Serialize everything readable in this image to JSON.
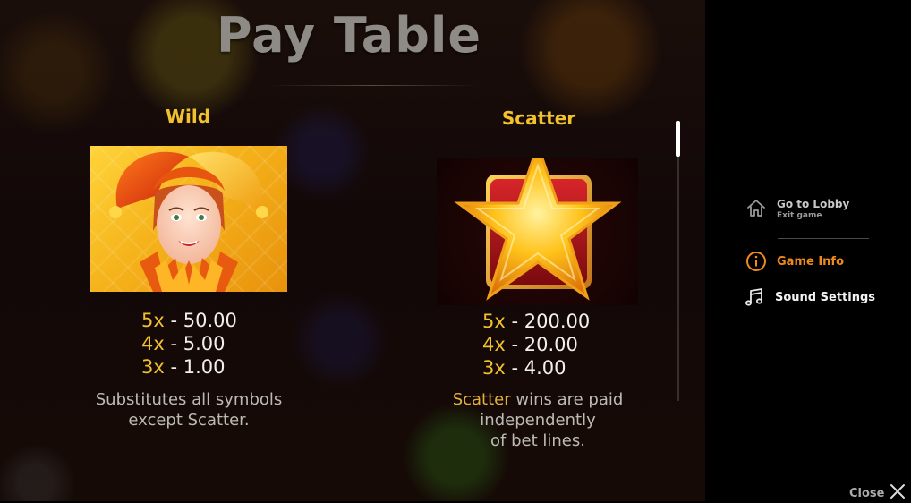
{
  "header": {
    "title": "Pay Table"
  },
  "wild": {
    "name": "Wild",
    "payouts": [
      {
        "mult": "5x",
        "sep": " - ",
        "value": "50.00"
      },
      {
        "mult": "4x",
        "sep": " - ",
        "value": "5.00"
      },
      {
        "mult": "3x",
        "sep": " - ",
        "value": "1.00"
      }
    ],
    "desc_line1": "Substitutes all symbols",
    "desc_line2": "except Scatter."
  },
  "scatter": {
    "name": "Scatter",
    "payouts": [
      {
        "mult": "5x",
        "sep": " - ",
        "value": "200.00"
      },
      {
        "mult": "4x",
        "sep": " - ",
        "value": "20.00"
      },
      {
        "mult": "3x",
        "sep": " - ",
        "value": "4.00"
      }
    ],
    "desc_highlight": "Scatter",
    "desc_line1_rest": " wins are paid",
    "desc_line2": "independently",
    "desc_line3": "of bet lines."
  },
  "menu": {
    "lobby_label": "Go to Lobby",
    "lobby_sub": "Exit game",
    "game_info_label": "Game Info",
    "sound_settings_label": "Sound Settings",
    "close_label": "Close"
  },
  "colors": {
    "accent_gold": "#f2c12e",
    "active_orange": "#f08a1e",
    "panel_bg": "#000000"
  },
  "icons": [
    "home-icon",
    "info-icon",
    "music-note-icon",
    "close-icon"
  ]
}
